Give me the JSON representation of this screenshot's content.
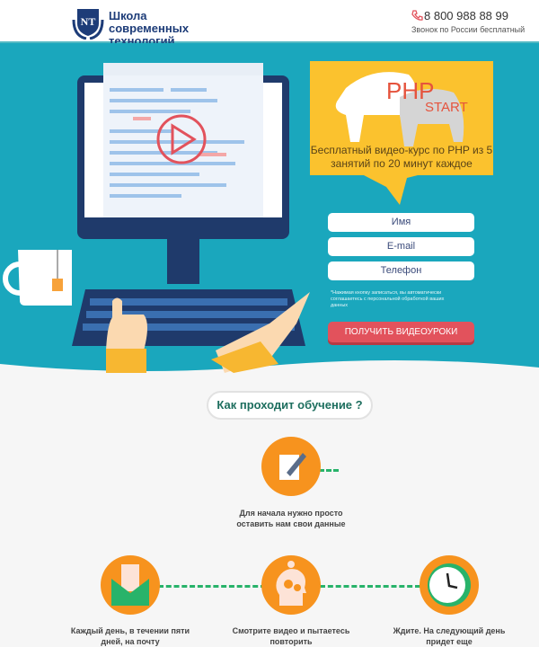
{
  "header": {
    "logo_letters": "NT",
    "logo_text": "Школа современных технологий",
    "phone": "8 800 988 88 99",
    "phone_note": "Звонок по России бесплатный"
  },
  "banner": {
    "title_1": "PHP",
    "title_2": "START",
    "subtitle": "Бесплатный видео-курс по PHP из 5 занятий по 20 минут каждое"
  },
  "form": {
    "name_placeholder": "Имя",
    "email_placeholder": "E-mail",
    "phone_placeholder": "Телефон",
    "note": "*Нажимая кнопку записаться, вы автоматически соглашаетесь с персональной обработкой ваших данных",
    "submit": "ПОЛУЧИТЬ ВИДЕОУРОКИ"
  },
  "colors": {
    "hero": "#1aa7bd",
    "banner": "#fbc22e",
    "button": "#e2525c",
    "step": "#f7931e",
    "line": "#28b36a"
  },
  "how": {
    "title": "Как проходит обучение ?",
    "steps": [
      {
        "icon": "pencil-paper-icon",
        "text": "Для начала нужно просто оставить нам свои данные"
      },
      {
        "icon": "envelope-icon",
        "text": "Каждый день, в течении пяти дней, на почту"
      },
      {
        "icon": "head-gears-icon",
        "text": "Смотрите видео и пытаетесь повторить"
      },
      {
        "icon": "clock-icon",
        "text": "Ждите. На следующий день придет еще"
      }
    ]
  }
}
